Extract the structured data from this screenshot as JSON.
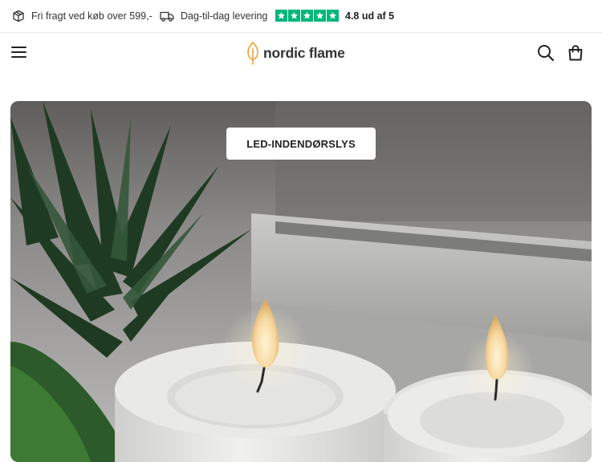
{
  "topbar": {
    "usp_shipping": "Fri fragt ved køb over 599,-",
    "usp_delivery": "Dag-til-dag levering",
    "rating_text": "4.8 ud af 5",
    "stars": 5,
    "trustpilot_color": "#00b67a"
  },
  "header": {
    "logo_text": "nordic flame",
    "logo_accent": "#f0a23a",
    "icons": [
      "menu-icon",
      "search-icon",
      "bag-icon"
    ]
  },
  "hero": {
    "category_label": "LED-INDENDØRSLYS"
  }
}
